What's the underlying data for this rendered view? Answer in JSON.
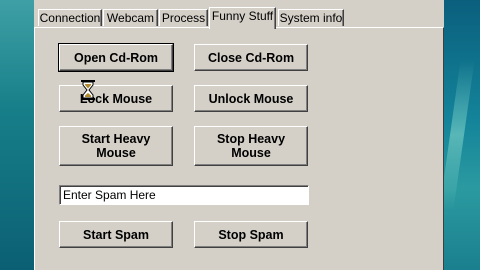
{
  "tabs": [
    {
      "label": "Connection",
      "active": false
    },
    {
      "label": "Webcam",
      "active": false
    },
    {
      "label": "Process",
      "active": false
    },
    {
      "label": "Funny Stuff",
      "active": true
    },
    {
      "label": "System info",
      "active": false
    }
  ],
  "buttons": {
    "open_cdrom": "Open Cd-Rom",
    "close_cdrom": "Close Cd-Rom",
    "lock_mouse": "Lock Mouse",
    "unlock_mouse": "Unlock Mouse",
    "start_heavy_mouse_line1": "Start Heavy",
    "start_heavy_mouse_line2": "Mouse",
    "stop_heavy_mouse_line1": "Stop Heavy",
    "stop_heavy_mouse_line2": "Mouse",
    "start_spam": "Start Spam",
    "stop_spam": "Stop Spam"
  },
  "spam_input": {
    "value": "Enter Spam Here"
  },
  "cursor": {
    "icon": "hourglass-icon"
  },
  "colors": {
    "face": "#d4d0c8",
    "desktop": "#0e6e8e"
  }
}
